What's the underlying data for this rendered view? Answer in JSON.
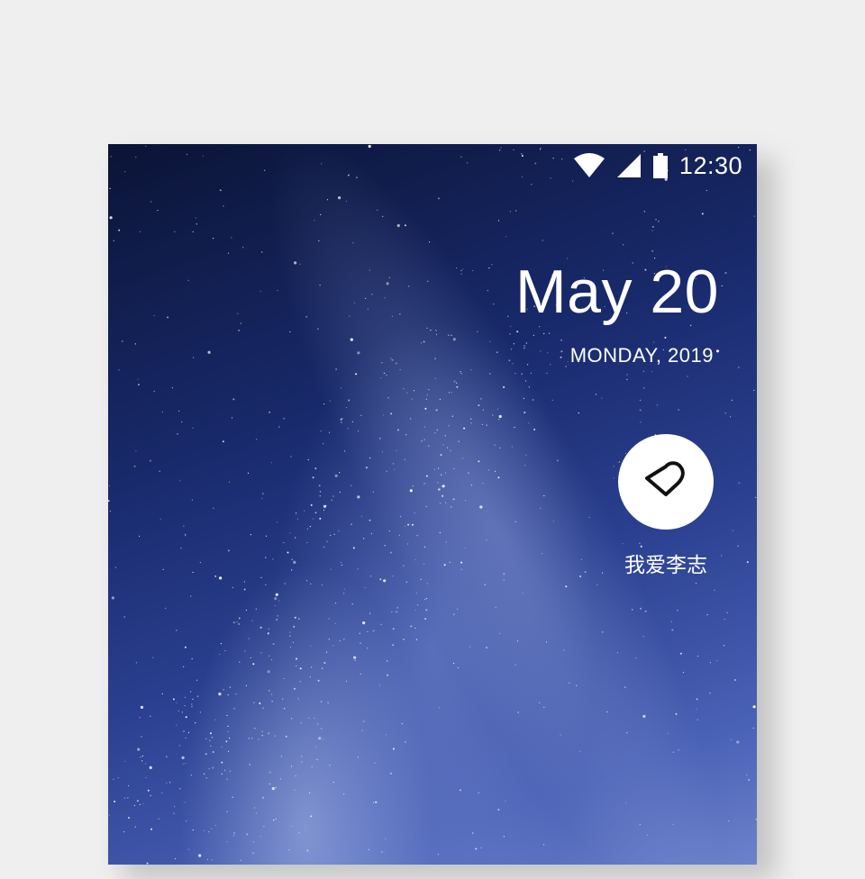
{
  "status_bar": {
    "time": "12:30",
    "icons": [
      "wifi-icon",
      "cell-signal-icon",
      "battery-icon"
    ]
  },
  "lockscreen": {
    "date": "May 20",
    "weekday_year": "MONDAY, 2019"
  },
  "shortcut": {
    "icon": "heart-icon",
    "label": "我爱李志"
  },
  "colors": {
    "sky_dark": "#0b1436",
    "sky_mid": "#2a3f8f",
    "sky_light": "#6c82cc",
    "text": "#ffffff",
    "page_background": "#efefef"
  }
}
